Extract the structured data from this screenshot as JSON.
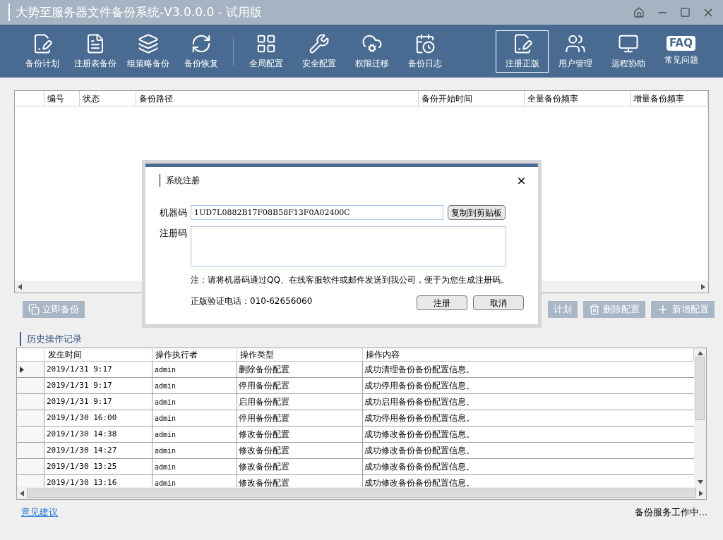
{
  "window": {
    "title": "大势至服务器文件备份系统-V3.0.0.0 - 试用版"
  },
  "toolbar": {
    "groups": [
      [
        {
          "label": "备份计划",
          "selected": false
        },
        {
          "label": "注册表备份",
          "selected": false
        },
        {
          "label": "组策略备份",
          "selected": false
        },
        {
          "label": "备份恢复",
          "selected": false
        }
      ],
      [
        {
          "label": "全局配置",
          "selected": false
        },
        {
          "label": "安全配置",
          "selected": false
        },
        {
          "label": "权限迁移",
          "selected": false
        },
        {
          "label": "备份日志",
          "selected": false
        }
      ]
    ],
    "right_items": [
      {
        "label": "注册正版",
        "selected": true
      },
      {
        "label": "用户管理",
        "selected": false
      },
      {
        "label": "远程协助",
        "selected": false
      },
      {
        "label": "常见问题",
        "selected": false,
        "badge": "FAQ"
      }
    ]
  },
  "plans_table": {
    "columns": [
      "编号",
      "状态",
      "备份路径",
      "备份开始时间",
      "全量备份频率",
      "增量备份频率"
    ]
  },
  "actions": {
    "left": "立即备份",
    "right": [
      {
        "label": "计划"
      },
      {
        "label": "删除配置"
      },
      {
        "label": "新增配置"
      }
    ]
  },
  "history": {
    "title": "历史操作记录",
    "columns": [
      "发生时间",
      "操作执行者",
      "操作类型",
      "操作内容"
    ],
    "rows": [
      {
        "time": "2019/1/31 9:17",
        "user": "admin",
        "type": "删除备份配置",
        "content": "成功清理备份备份配置信息。",
        "selected": true
      },
      {
        "time": "2019/1/31 9:17",
        "user": "admin",
        "type": "停用备份配置",
        "content": "成功停用备份备份配置信息。",
        "selected": false
      },
      {
        "time": "2019/1/31 9:17",
        "user": "admin",
        "type": "启用备份配置",
        "content": "成功启用备份备份配置信息。",
        "selected": false
      },
      {
        "time": "2019/1/30 16:00",
        "user": "admin",
        "type": "停用备份配置",
        "content": "成功停用备份备份配置信息。",
        "selected": false
      },
      {
        "time": "2019/1/30 14:38",
        "user": "admin",
        "type": "修改备份配置",
        "content": "成功修改备份备份配置信息。",
        "selected": false
      },
      {
        "time": "2019/1/30 14:27",
        "user": "admin",
        "type": "修改备份配置",
        "content": "成功修改备份备份配置信息。",
        "selected": false
      },
      {
        "time": "2019/1/30 13:25",
        "user": "admin",
        "type": "修改备份配置",
        "content": "成功修改备份备份配置信息。",
        "selected": false
      },
      {
        "time": "2019/1/30 13:16",
        "user": "admin",
        "type": "修改备份配置",
        "content": "成功修改备份备份配置信息。",
        "selected": false
      }
    ]
  },
  "footer": {
    "link": "意见建议",
    "status": "备份服务工作中..."
  },
  "dialog": {
    "title": "系统注册",
    "machine_label": "机器码",
    "machine_code": "1UD7L0882B17F08B58F13F0A02400C",
    "copy_button": "复制到剪贴板",
    "reg_label": "注册码",
    "note": "注：请将机器码通过QQ、在线客服软件或邮件发送到我公司，便于为您生成注册码。",
    "phone": "正版验证电话：010-62656060",
    "ok": "注册",
    "cancel": "取消"
  }
}
